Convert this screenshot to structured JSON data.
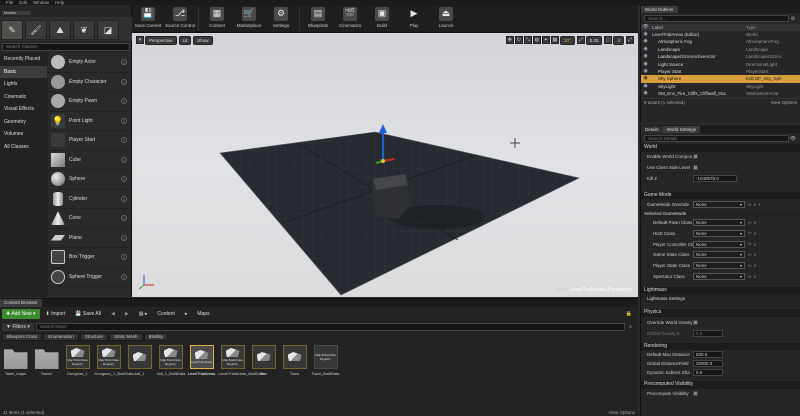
{
  "menu": [
    "File",
    "Edit",
    "Window",
    "Help"
  ],
  "modes": {
    "tab": "Modes",
    "search_placeholder": "Search Classes",
    "categories": [
      "Recently Placed",
      "Basic",
      "Lights",
      "Cinematic",
      "Visual Effects",
      "Geometry",
      "Volumes",
      "All Classes"
    ],
    "items": [
      "Empty Actor",
      "Empty Character",
      "Empty Pawn",
      "Point Light",
      "Player Start",
      "Cube",
      "Sphere",
      "Cylinder",
      "Cone",
      "Plane",
      "Box Trigger",
      "Sphere Trigger"
    ]
  },
  "toolbar": {
    "buttons": [
      "Save Current",
      "Source Control",
      "Content",
      "Marketplace",
      "Settings",
      "Blueprints",
      "Cinematics",
      "Build",
      "Play",
      "Launch"
    ]
  },
  "viewport": {
    "perspective": "Perspective",
    "lit": "Lit",
    "show": "Show",
    "angle": "10°",
    "scale": "0.25",
    "cam_speed": "4",
    "level_prefix": "Level: ",
    "level_name": "LevelTrailAreas (Persistent)"
  },
  "outliner": {
    "tab": "World Outliner",
    "search_placeholder": "Search...",
    "col_label": "Label",
    "col_type": "Type",
    "rows": [
      {
        "label": "LevelTrialAreas (Editor)",
        "type": "World"
      },
      {
        "label": "Atmospheric Fog",
        "type": "AtmosphericFog"
      },
      {
        "label": "Landscape",
        "type": "Landscape"
      },
      {
        "label": "LandscapeGizmoActiveActor",
        "type": "LandscapeGizmo..."
      },
      {
        "label": "Light Source",
        "type": "DirectionalLight"
      },
      {
        "label": "Player Start",
        "type": "PlayerStart"
      },
      {
        "label": "Sky Sphere",
        "type": "Edit BP_Sky_Sph"
      },
      {
        "label": "SkyLight",
        "type": "SkyLight"
      },
      {
        "label": "SM_Env_Fire_Cliffs_Cliffwall_01a",
        "type": "StaticMeshActor"
      }
    ],
    "selected_index": 6,
    "status": "9 actors (1 selected)",
    "view_options": "View Options"
  },
  "details": {
    "tab_details": "Details",
    "tab_world": "World Settings",
    "search_placeholder": "Search Details",
    "world_section": "World",
    "enable_world_compos": "Enable World Compos",
    "use_client_side_level": "Use Client Side Level",
    "kill_z_label": "Kill Z",
    "kill_z_value": "-1048575.0",
    "gamemode_section": "Game Mode",
    "gamemode_override_label": "GameMode Override",
    "none": "None",
    "selected_gamemode": "Selected GameMode",
    "gm_props": [
      "Default Pawn Class",
      "HUD Class",
      "Player Controller Cla",
      "Game State Class",
      "Player State Class",
      "Spectator Class"
    ],
    "lightmass_section": "Lightmass",
    "lightmass_settings": "Lightmass Settings",
    "physics_section": "Physics",
    "override_world_gravity": "Override World Gravity",
    "global_gravity_z": "Global Gravity Z",
    "global_gravity_z_value": "0.0",
    "rendering_section": "Rendering",
    "default_max_distance": "Default Max Distance",
    "default_max_distance_value": "600.0",
    "global_distance_field": "Global DistanceField",
    "global_distance_field_value": "20000.0",
    "dynamic_indirect_sha": "Dynamic Indirect Sha",
    "dynamic_indirect_sha_value": "0.8",
    "precomputed_section": "Precomputed Visibility",
    "precompute_visibility": "Precompute Visibility"
  },
  "content": {
    "tab": "Content Browser",
    "add_new": "Add New",
    "import": "Import",
    "save_all": "Save All",
    "path_content": "Content",
    "path_maps": "Maps",
    "filters": "Filters",
    "search_placeholder": "Search Maps",
    "chips": [
      "Blueprint Class",
      "Enumeration",
      "Structure",
      "Static Mesh",
      "Blutility"
    ],
    "assets": [
      {
        "label": "Town_maps",
        "kind": "folder",
        "thumb": ""
      },
      {
        "label": "Town2",
        "kind": "folder",
        "thumb": ""
      },
      {
        "label": "Dungeon_1",
        "kind": "map",
        "thumb": "Map Build Data Registry"
      },
      {
        "label": "Dungeon_1_BuiltData",
        "kind": "map",
        "thumb": "Map Build Data Registry"
      },
      {
        "label": "Jail_1",
        "kind": "map",
        "thumb": ""
      },
      {
        "label": "Jail_1_BuiltData",
        "kind": "map",
        "thumb": "Map Build Data Registry"
      },
      {
        "label": "LevelTrialAreas",
        "kind": "map-sel",
        "thumb": "LevelTrial Areas"
      },
      {
        "label": "LevelTrialAreas_BuiltData",
        "kind": "map",
        "thumb": "Map Build Data Registry"
      },
      {
        "label": "Test",
        "kind": "map",
        "thumb": ""
      },
      {
        "label": "Town",
        "kind": "map",
        "thumb": ""
      },
      {
        "label": "Town_BuiltData",
        "kind": "map-plain",
        "thumb": "Map Build Data Registry"
      }
    ],
    "status": "11 items (1 selected)",
    "view_options": "View Options"
  }
}
